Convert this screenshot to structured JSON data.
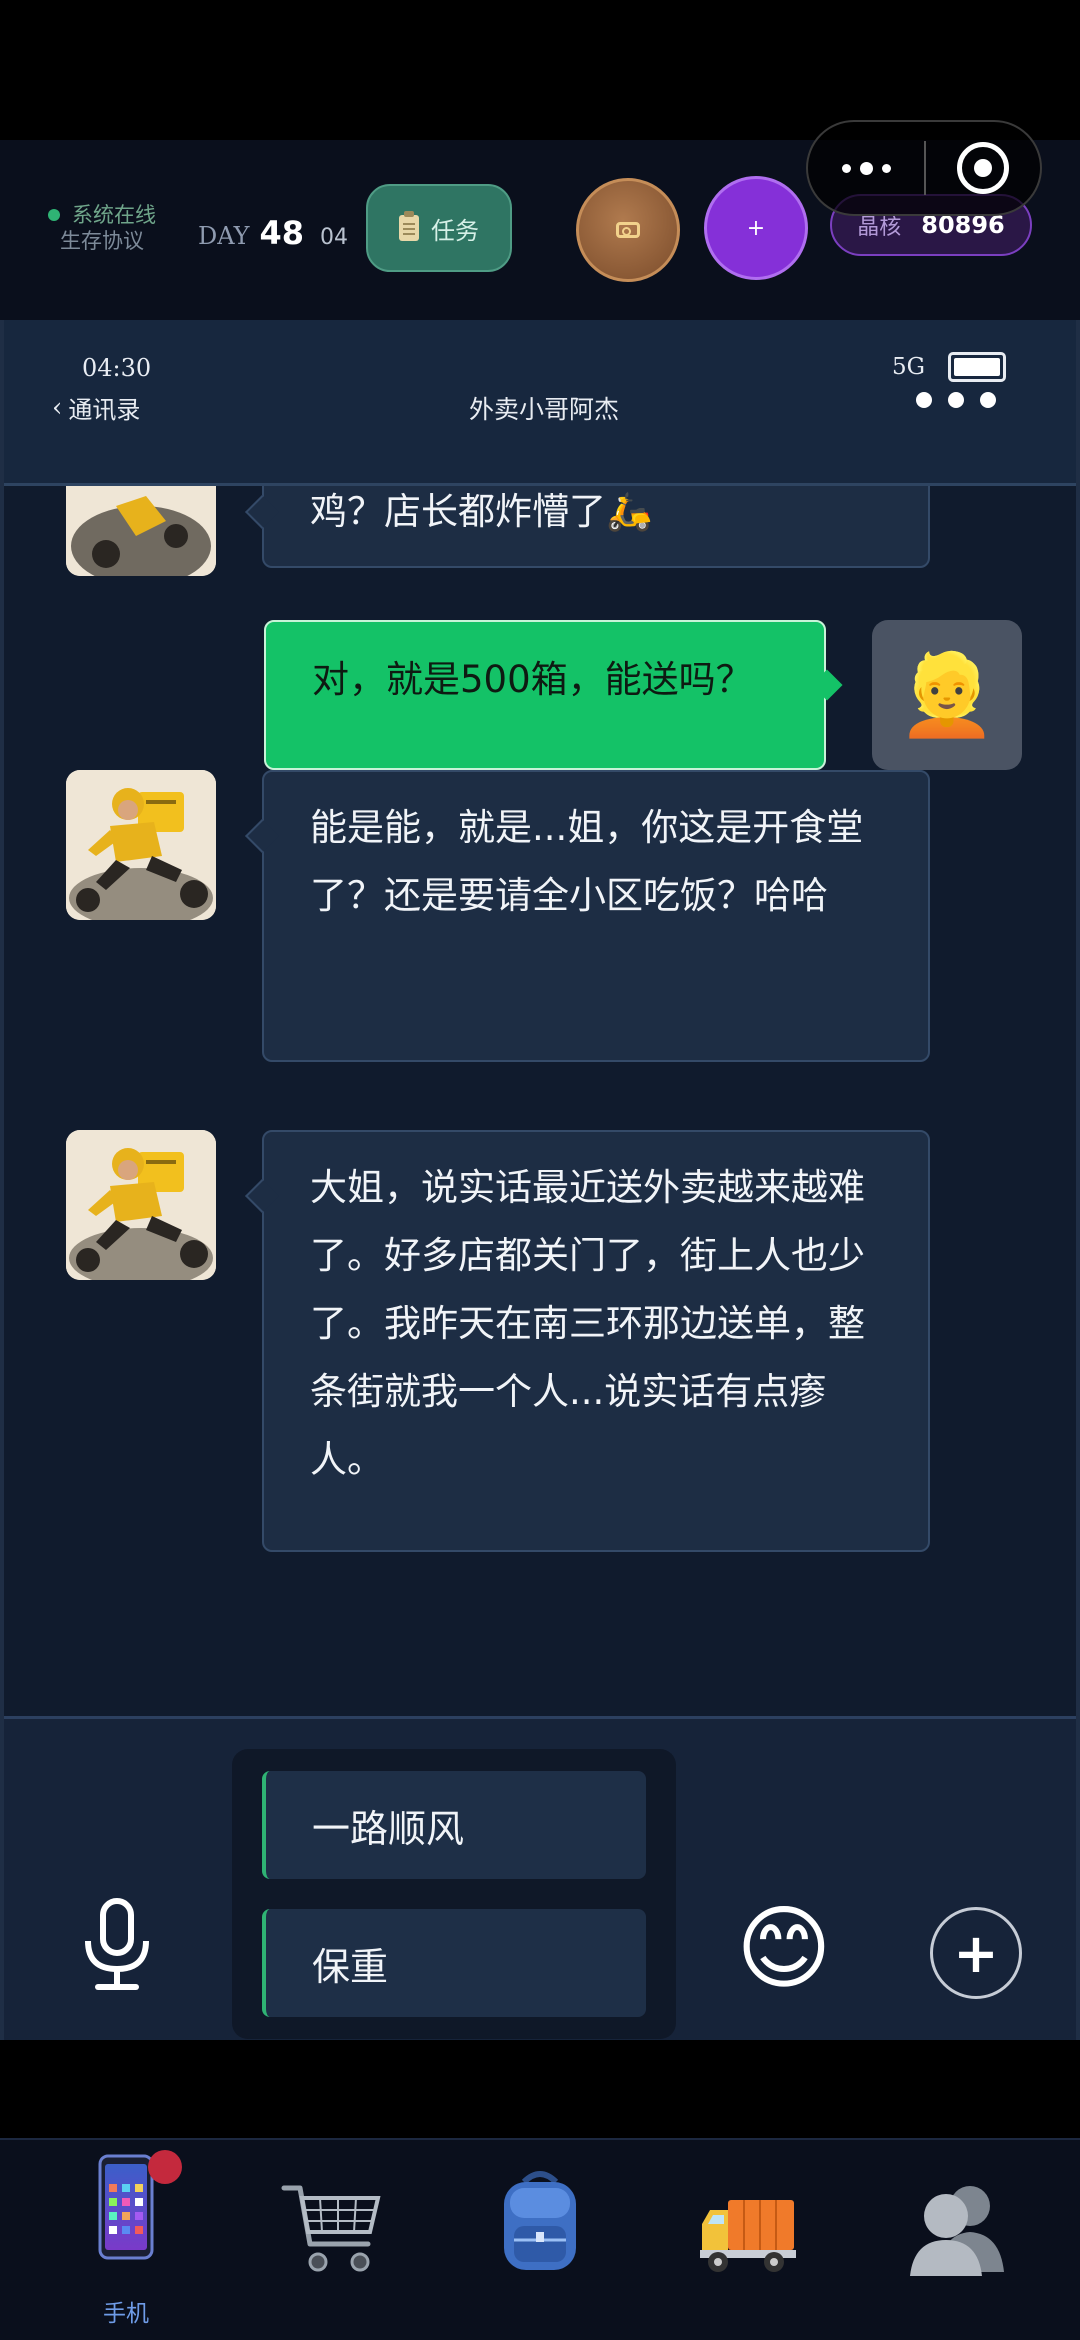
{
  "header": {
    "status_line1": "系统在线",
    "status_line2": "生存协议",
    "day_label": "DAY",
    "day_number": "48",
    "day_sub": "04",
    "task_label": "任务",
    "plus_label": "+",
    "crystal_label": "晶核",
    "crystal_value": "80896"
  },
  "phone": {
    "time": "04:30",
    "network": "5G",
    "back_label": "通讯录",
    "contact_name": "外卖小哥阿杰"
  },
  "messages": [
    {
      "from": "contact",
      "text": "鸡？店长都炸懵了🛵"
    },
    {
      "from": "me",
      "text": "对，就是500箱，能送吗？",
      "avatar": "👱"
    },
    {
      "from": "contact",
      "text": "能是能，就是...姐，你这是开食堂了？还是要请全小区吃饭？哈哈"
    },
    {
      "from": "contact",
      "text": "大姐，说实话最近送外卖越来越难了。好多店都关门了，街上人也少了。我昨天在南三环那边送单，整条街就我一个人...说实话有点瘆人。"
    }
  ],
  "input": {
    "suggestions": [
      "一路顺风",
      "保重"
    ],
    "emoji": "😊",
    "add": "+"
  },
  "tabbar": {
    "tabs": [
      {
        "label": "手机",
        "icon": "phone-icon",
        "active": true
      },
      {
        "label": "",
        "icon": "shopping-cart-icon"
      },
      {
        "label": "",
        "icon": "backpack-icon"
      },
      {
        "label": "",
        "icon": "delivery-truck-icon"
      },
      {
        "label": "",
        "icon": "contacts-icon"
      }
    ]
  },
  "colors": {
    "accent_green": "#14c267",
    "crystal_purple": "#8530d8",
    "badge_red": "#c4293d"
  }
}
